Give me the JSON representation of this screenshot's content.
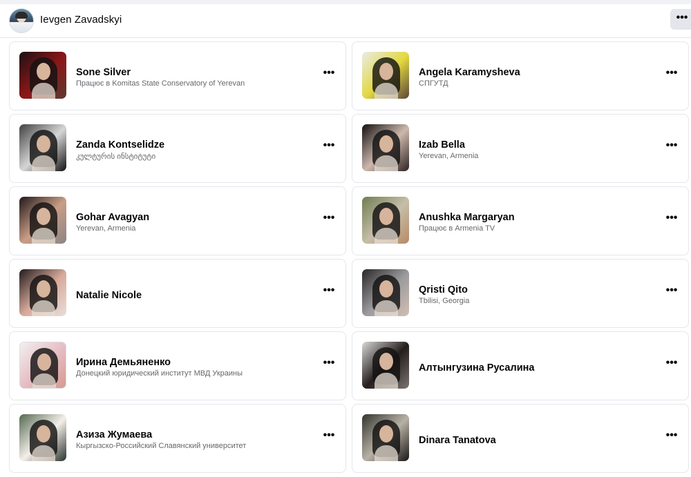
{
  "header": {
    "name": "Ievgen Zavadskyi",
    "more_label": "•••"
  },
  "cards": [
    {
      "name": "Sone Silver",
      "subtitle": "Працює в Komitas State Conservatory of Yerevan",
      "more_label": "•••",
      "thumb_colors": [
        "#1b1113",
        "#8b1718",
        "#5b3b31"
      ]
    },
    {
      "name": "Angela Karamysheva",
      "subtitle": "СПГУТД",
      "more_label": "•••",
      "thumb_colors": [
        "#e9ece8",
        "#e3d840",
        "#5a4639"
      ]
    },
    {
      "name": "Zanda Kontselidze",
      "subtitle": "კულტურის ინსტიტუტი",
      "more_label": "•••",
      "thumb_colors": [
        "#404040",
        "#d6d6d6",
        "#111111"
      ]
    },
    {
      "name": "Izab Bella",
      "subtitle": "Yerevan, Armenia",
      "more_label": "•••",
      "thumb_colors": [
        "#130f10",
        "#cdb8ad",
        "#2d2424"
      ]
    },
    {
      "name": "Gohar Avagyan",
      "subtitle": "Yerevan, Armenia",
      "more_label": "•••",
      "thumb_colors": [
        "#1f1718",
        "#c99d86",
        "#8a8585"
      ]
    },
    {
      "name": "Anushka Margaryan",
      "subtitle": "Працює в Armenia TV",
      "more_label": "•••",
      "thumb_colors": [
        "#6f7d50",
        "#c6bea9",
        "#b78b67"
      ]
    },
    {
      "name": "Natalie Nicole",
      "subtitle": "",
      "more_label": "•••",
      "thumb_colors": [
        "#211b1d",
        "#d7a99b",
        "#e7dfdb"
      ]
    },
    {
      "name": "Qristi Qito",
      "subtitle": "Tbilisi, Georgia",
      "more_label": "•••",
      "thumb_colors": [
        "#2b2628",
        "#9b9a9d",
        "#d3bfb4"
      ]
    },
    {
      "name": "Ирина Демьяненко",
      "subtitle": "Донецкий юридический институт МВД Украины",
      "more_label": "•••",
      "thumb_colors": [
        "#f2f0f0",
        "#e6bdc4",
        "#d59a8f"
      ]
    },
    {
      "name": "Алтынгузина Русалина",
      "subtitle": "",
      "more_label": "•••",
      "thumb_colors": [
        "#d9d9d7",
        "#241e1d",
        "#7b7471"
      ]
    },
    {
      "name": "Азиза Жумаева",
      "subtitle": "Кыргызско-Российский Славянский университет",
      "more_label": "•••",
      "thumb_colors": [
        "#536951",
        "#f4efe9",
        "#28332d"
      ]
    },
    {
      "name": "Dinara Tanatova",
      "subtitle": "",
      "more_label": "•••",
      "thumb_colors": [
        "#32352f",
        "#b8b1a5",
        "#1a1716"
      ]
    }
  ]
}
